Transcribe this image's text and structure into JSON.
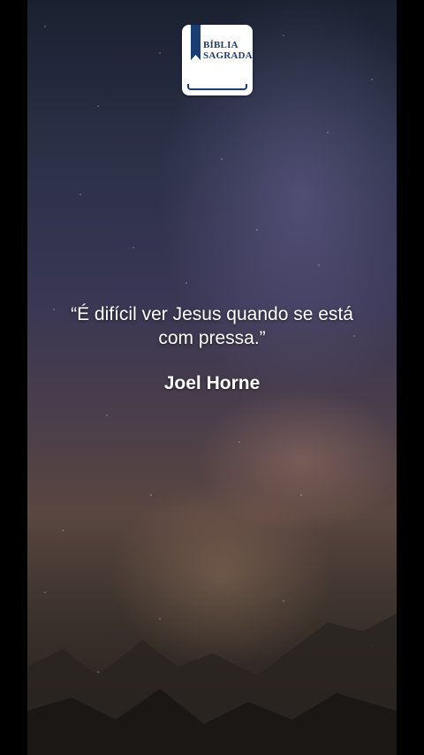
{
  "app": {
    "logo_line1": "BÍBLIA",
    "logo_line2": "SAGRADA"
  },
  "quote": {
    "text": "“É difícil ver Jesus quando se está com pressa.”",
    "author": "Joel Horne"
  },
  "colors": {
    "logo_blue": "#1a3d74",
    "logo_bookmark": "#1a3d74",
    "text": "#ffffff",
    "letterbox": "#000000"
  },
  "icons": {
    "logo": "bible-book-icon"
  }
}
